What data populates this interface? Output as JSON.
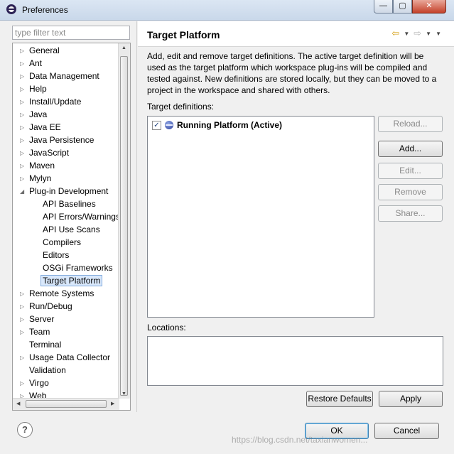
{
  "window": {
    "title": "Preferences",
    "min_glyph": "—",
    "max_glyph": "▢",
    "close_glyph": "✕"
  },
  "filter": {
    "placeholder": "type filter text",
    "value": ""
  },
  "tree": {
    "items": [
      {
        "label": "General",
        "expandable": true,
        "indent": 0
      },
      {
        "label": "Ant",
        "expandable": true,
        "indent": 0
      },
      {
        "label": "Data Management",
        "expandable": true,
        "indent": 0
      },
      {
        "label": "Help",
        "expandable": true,
        "indent": 0
      },
      {
        "label": "Install/Update",
        "expandable": true,
        "indent": 0
      },
      {
        "label": "Java",
        "expandable": true,
        "indent": 0
      },
      {
        "label": "Java EE",
        "expandable": true,
        "indent": 0
      },
      {
        "label": "Java Persistence",
        "expandable": true,
        "indent": 0
      },
      {
        "label": "JavaScript",
        "expandable": true,
        "indent": 0
      },
      {
        "label": "Maven",
        "expandable": true,
        "indent": 0
      },
      {
        "label": "Mylyn",
        "expandable": true,
        "indent": 0
      },
      {
        "label": "Plug-in Development",
        "expandable": true,
        "expanded": true,
        "indent": 0
      },
      {
        "label": "API Baselines",
        "indent": 1
      },
      {
        "label": "API Errors/Warnings",
        "indent": 1
      },
      {
        "label": "API Use Scans",
        "indent": 1
      },
      {
        "label": "Compilers",
        "indent": 1
      },
      {
        "label": "Editors",
        "indent": 1
      },
      {
        "label": "OSGi Frameworks",
        "indent": 1
      },
      {
        "label": "Target Platform",
        "indent": 1,
        "selected": true
      },
      {
        "label": "Remote Systems",
        "expandable": true,
        "indent": 0
      },
      {
        "label": "Run/Debug",
        "expandable": true,
        "indent": 0
      },
      {
        "label": "Server",
        "expandable": true,
        "indent": 0
      },
      {
        "label": "Team",
        "expandable": true,
        "indent": 0
      },
      {
        "label": "Terminal",
        "indent": 0
      },
      {
        "label": "Usage Data Collector",
        "expandable": true,
        "indent": 0
      },
      {
        "label": "Validation",
        "indent": 0
      },
      {
        "label": "Virgo",
        "expandable": true,
        "indent": 0
      },
      {
        "label": "Web",
        "expandable": true,
        "indent": 0
      }
    ]
  },
  "page": {
    "title": "Target Platform",
    "description": "Add, edit and remove target definitions.  The active target definition will be used as the target platform which workspace plug-ins will be compiled and tested against.  New definitions are stored locally, but they can be moved to a project in the workspace and shared with others.",
    "definitions_label": "Target definitions:",
    "definitions": [
      {
        "name": "Running Platform (Active)",
        "checked": true
      }
    ],
    "buttons": {
      "reload": "Reload...",
      "add": "Add...",
      "edit": "Edit...",
      "remove": "Remove",
      "share": "Share..."
    },
    "locations_label": "Locations:",
    "restore_defaults": "Restore Defaults",
    "apply": "Apply"
  },
  "dialog": {
    "help": "?",
    "ok": "OK",
    "cancel": "Cancel"
  },
  "watermark": "https://blog.csdn.net/taxianwomen..."
}
